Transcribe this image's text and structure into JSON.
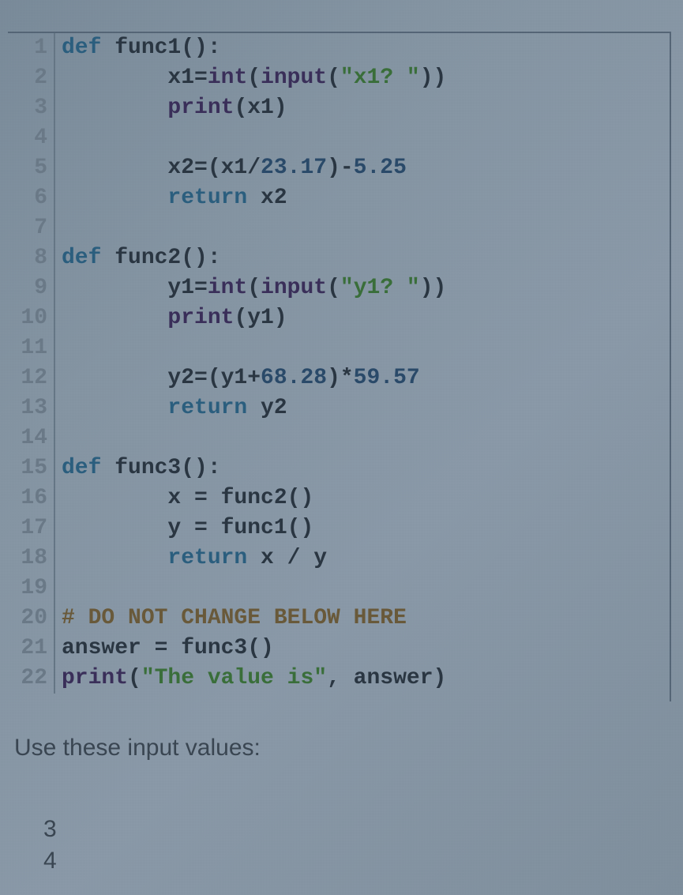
{
  "code": {
    "lines": [
      {
        "num": 1,
        "tokens": [
          {
            "t": "def ",
            "c": "keyword"
          },
          {
            "t": "func1",
            "c": "default"
          },
          {
            "t": "():",
            "c": "default"
          }
        ]
      },
      {
        "num": 2,
        "tokens": [
          {
            "t": "        x1=",
            "c": "default"
          },
          {
            "t": "int",
            "c": "builtin"
          },
          {
            "t": "(",
            "c": "default"
          },
          {
            "t": "input",
            "c": "builtin"
          },
          {
            "t": "(",
            "c": "default"
          },
          {
            "t": "\"x1? \"",
            "c": "string"
          },
          {
            "t": "))",
            "c": "default"
          }
        ]
      },
      {
        "num": 3,
        "tokens": [
          {
            "t": "        ",
            "c": "default"
          },
          {
            "t": "print",
            "c": "builtin"
          },
          {
            "t": "(x1)",
            "c": "default"
          }
        ]
      },
      {
        "num": 4,
        "tokens": [
          {
            "t": "",
            "c": "default"
          }
        ]
      },
      {
        "num": 5,
        "tokens": [
          {
            "t": "        x2=(x1/",
            "c": "default"
          },
          {
            "t": "23.17",
            "c": "number"
          },
          {
            "t": ")-",
            "c": "default"
          },
          {
            "t": "5.25",
            "c": "number"
          }
        ]
      },
      {
        "num": 6,
        "tokens": [
          {
            "t": "        ",
            "c": "default"
          },
          {
            "t": "return ",
            "c": "keyword"
          },
          {
            "t": "x2",
            "c": "default"
          }
        ]
      },
      {
        "num": 7,
        "tokens": [
          {
            "t": "",
            "c": "default"
          }
        ]
      },
      {
        "num": 8,
        "tokens": [
          {
            "t": "def ",
            "c": "keyword"
          },
          {
            "t": "func2",
            "c": "default"
          },
          {
            "t": "():",
            "c": "default"
          }
        ]
      },
      {
        "num": 9,
        "tokens": [
          {
            "t": "        y1=",
            "c": "default"
          },
          {
            "t": "int",
            "c": "builtin"
          },
          {
            "t": "(",
            "c": "default"
          },
          {
            "t": "input",
            "c": "builtin"
          },
          {
            "t": "(",
            "c": "default"
          },
          {
            "t": "\"y1? \"",
            "c": "string"
          },
          {
            "t": "))",
            "c": "default"
          }
        ]
      },
      {
        "num": 10,
        "tokens": [
          {
            "t": "        ",
            "c": "default"
          },
          {
            "t": "print",
            "c": "builtin"
          },
          {
            "t": "(y1)",
            "c": "default"
          }
        ]
      },
      {
        "num": 11,
        "tokens": [
          {
            "t": "",
            "c": "default"
          }
        ]
      },
      {
        "num": 12,
        "tokens": [
          {
            "t": "        y2=(y1+",
            "c": "default"
          },
          {
            "t": "68.28",
            "c": "number"
          },
          {
            "t": ")*",
            "c": "default"
          },
          {
            "t": "59.57",
            "c": "number"
          }
        ]
      },
      {
        "num": 13,
        "tokens": [
          {
            "t": "        ",
            "c": "default"
          },
          {
            "t": "return ",
            "c": "keyword"
          },
          {
            "t": "y2",
            "c": "default"
          }
        ]
      },
      {
        "num": 14,
        "tokens": [
          {
            "t": "",
            "c": "default"
          }
        ]
      },
      {
        "num": 15,
        "tokens": [
          {
            "t": "def ",
            "c": "keyword"
          },
          {
            "t": "func3",
            "c": "default"
          },
          {
            "t": "():",
            "c": "default"
          }
        ]
      },
      {
        "num": 16,
        "tokens": [
          {
            "t": "        x = func2()",
            "c": "default"
          }
        ]
      },
      {
        "num": 17,
        "tokens": [
          {
            "t": "        y = func1()",
            "c": "default"
          }
        ]
      },
      {
        "num": 18,
        "tokens": [
          {
            "t": "        ",
            "c": "default"
          },
          {
            "t": "return ",
            "c": "keyword"
          },
          {
            "t": "x / y",
            "c": "default"
          }
        ]
      },
      {
        "num": 19,
        "tokens": [
          {
            "t": "",
            "c": "default"
          }
        ]
      },
      {
        "num": 20,
        "tokens": [
          {
            "t": "# DO NOT CHANGE BELOW HERE",
            "c": "comment"
          }
        ]
      },
      {
        "num": 21,
        "tokens": [
          {
            "t": "answer = func3()",
            "c": "default"
          }
        ]
      },
      {
        "num": 22,
        "tokens": [
          {
            "t": "print",
            "c": "builtin"
          },
          {
            "t": "(",
            "c": "default"
          },
          {
            "t": "\"The value is\"",
            "c": "string"
          },
          {
            "t": ", answer)",
            "c": "default"
          }
        ]
      }
    ]
  },
  "prompt": "Use these input values:",
  "inputs": [
    "3",
    "4"
  ]
}
